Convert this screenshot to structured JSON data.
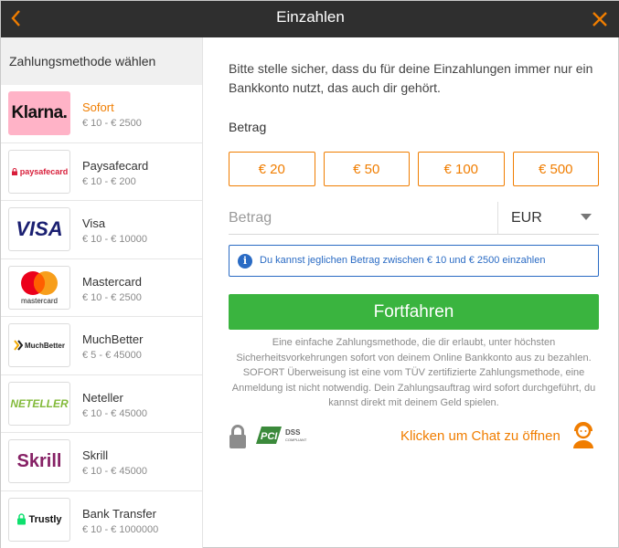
{
  "header": {
    "title": "Einzahlen",
    "back_icon": "chevron-left-icon",
    "close_icon": "close-icon",
    "accent": "#f07d00"
  },
  "sidebar": {
    "title": "Zahlungsmethode wählen",
    "methods": [
      {
        "name": "Sofort",
        "range": "€ 10 - € 2500",
        "logo_text": "Klarna.",
        "active": true
      },
      {
        "name": "Paysafecard",
        "range": "€ 10 - € 200",
        "logo_text": "paysafecard"
      },
      {
        "name": "Visa",
        "range": "€ 10 - € 10000",
        "logo_text": "VISA"
      },
      {
        "name": "Mastercard",
        "range": "€ 10 - € 2500",
        "logo_text": "mastercard"
      },
      {
        "name": "MuchBetter",
        "range": "€ 5 - € 45000",
        "logo_text": "MuchBetter"
      },
      {
        "name": "Neteller",
        "range": "€ 10 - € 45000",
        "logo_text": "NETELLER"
      },
      {
        "name": "Skrill",
        "range": "€ 10 - € 45000",
        "logo_text": "Skrill"
      },
      {
        "name": "Bank Transfer",
        "range": "€ 10 - € 1000000",
        "logo_text": "Trustly"
      }
    ]
  },
  "main": {
    "notice": "Bitte stelle sicher, dass du für deine Einzahlungen immer nur ein Bankkonto nutzt, das auch dir gehört.",
    "amount_label": "Betrag",
    "presets": [
      "€ 20",
      "€ 50",
      "€ 100",
      "€ 500"
    ],
    "amount_input": {
      "placeholder": "Betrag",
      "value": ""
    },
    "currency": "EUR",
    "info": "Du kannst jeglichen Betrag zwischen € 10 und € 2500 einzahlen",
    "continue_label": "Fortfahren",
    "description": "Eine einfache Zahlungsmethode, die dir erlaubt, unter höchsten Sicherheitsvorkehrungen sofort von deinem Online Bankkonto aus zu bezahlen. SOFORT Überweisung ist eine vom TÜV zertifizierte Zahlungsmethode, eine Anmeldung ist nicht notwendig. Dein Zahlungsauftrag wird sofort durchgeführt, du kannst direkt mit deinem Geld spielen.",
    "pci_logo_text": "PCI DSS",
    "pci_logo_small": "COMPLIANT",
    "chat_link": "Klicken um Chat zu öffnen",
    "colors": {
      "green": "#3ab43f",
      "blue": "#2a6bc4",
      "orange": "#f07d00"
    }
  }
}
